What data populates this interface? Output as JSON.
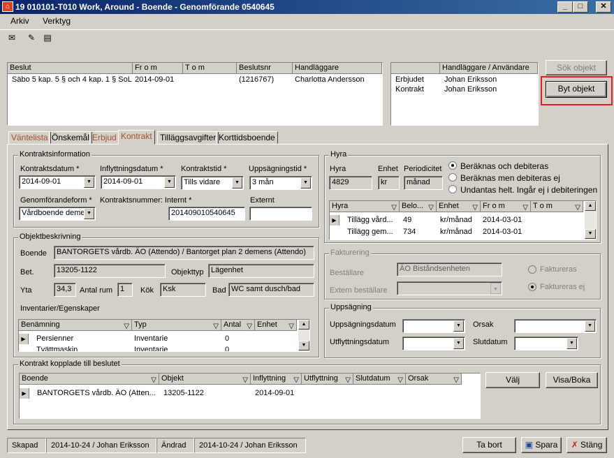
{
  "window": {
    "title": "19 010101-T010  Work, Around   -  Boende - Genomförande   0540645"
  },
  "menu": [
    "Arkiv",
    "Verktyg"
  ],
  "decisions": {
    "headers": [
      "Beslut",
      "Fr o m",
      "T o m",
      "Beslutsnr",
      "Handläggare"
    ],
    "rows": [
      [
        "Säbo 5 kap. 5 § och 4 kap. 1 § SoL",
        "2014-09-01",
        "",
        "(1216767)",
        "Charlotta Andersson"
      ]
    ]
  },
  "handlers": {
    "headers": [
      "",
      "Handläggare / Användare"
    ],
    "rows": [
      [
        "Erbjudet",
        "Johan Eriksson"
      ],
      [
        "Kontrakt",
        "Johan Eriksson"
      ]
    ]
  },
  "buttons": {
    "search_object": "Sök objekt",
    "change_object": "Byt objekt",
    "choose": "Välj",
    "view_book": "Visa/Boka",
    "delete": "Ta bort",
    "save": "Spara",
    "close": "Stäng"
  },
  "tabs": [
    "Väntelista",
    "Önskemål",
    "Erbjud",
    "Kontrakt",
    "Tilläggsavgifter",
    "Korttidsboende"
  ],
  "contract_info": {
    "title": "Kontraktsinformation",
    "contract_date_label": "Kontraktsdatum *",
    "contract_date": "2014-09-01",
    "move_in_label": "Inflyttningsdatum *",
    "move_in": "2014-09-01",
    "duration_label": "Kontraktstid *",
    "duration": "Tills vidare",
    "notice_label": "Uppsägningstid *",
    "notice": "3 mån",
    "form_label": "Genomförandeform *",
    "form": "Vårdboende deme",
    "number_label": "Kontraktsnummer: Internt *",
    "number": "201409010540645",
    "external_label": "Externt",
    "external": ""
  },
  "object_desc": {
    "title": "Objektbeskrivning",
    "housing_label": "Boende",
    "housing": "BANTORGETS vårdb. ÄO (Attendo) / Bantorget plan 2 demens (Attendo)",
    "bet_label": "Bet.",
    "bet": "13205-1122",
    "type_label": "Objekttyp",
    "type": "Lägenhet",
    "area_label": "Yta",
    "area": "34,3",
    "rooms_label": "Antal rum",
    "rooms": "1",
    "kitchen_label": "Kök",
    "kitchen": "Ksk",
    "bath_label": "Bad",
    "bath": "WC samt dusch/bad",
    "inventory_label": "Inventarier/Egenskaper",
    "inventory_headers": [
      "Benämning",
      "Typ",
      "Antal",
      "Enhet"
    ],
    "inventory_rows": [
      [
        "Persienner",
        "Inventarie",
        "0",
        ""
      ],
      [
        "Tvättmaskin",
        "Inventarie",
        "0",
        ""
      ]
    ]
  },
  "rent": {
    "title": "Hyra",
    "rent_label": "Hyra",
    "rent": "4829",
    "unit_label": "Enhet",
    "unit": "kr",
    "period_label": "Periodicitet",
    "period": "månad",
    "options": [
      "Beräknas och debiteras",
      "Beräknas men debiteras ej",
      "Undantas helt. Ingår ej i debiteringen"
    ],
    "selected_option": 0,
    "headers": [
      "Hyra",
      "Belo...",
      "Enhet",
      "Fr o m",
      "T o m"
    ],
    "rows": [
      [
        "Tillägg vård...",
        "49",
        "kr/månad",
        "2014-03-01",
        ""
      ],
      [
        "Tillägg gem...",
        "734",
        "kr/månad",
        "2014-03-01",
        ""
      ]
    ]
  },
  "billing": {
    "title": "Fakturering",
    "payer_label": "Beställare",
    "payer": "ÄO Biståndsenheten",
    "ext_payer_label": "Extern beställare",
    "ext_payer": "",
    "options": [
      "Faktureras",
      "Faktureras ej"
    ],
    "selected_option": 1
  },
  "termination": {
    "title": "Uppsägning",
    "notice_date_label": "Uppsägningsdatum",
    "move_out_label": "Utflyttningsdatum",
    "reason_label": "Orsak",
    "end_date_label": "Slutdatum"
  },
  "linked": {
    "title": "Kontrakt kopplade till beslutet",
    "headers": [
      "Boende",
      "Objekt",
      "Inflyttning",
      "Utflyttning",
      "Slutdatum",
      "Orsak"
    ],
    "rows": [
      [
        "BANTORGETS vårdb. ÄO (Atten...",
        "13205-1122",
        "2014-09-01",
        "",
        "",
        ""
      ]
    ]
  },
  "status": {
    "created_label": "Skapad",
    "created": "2014-10-24 / Johan Eriksson",
    "changed_label": "Ändrad",
    "changed": "2014-10-24 / Johan Eriksson"
  },
  "colors": {
    "highlight": "#e02020",
    "titlebar": "#0a246a",
    "tab_orange": "#a0522d"
  }
}
